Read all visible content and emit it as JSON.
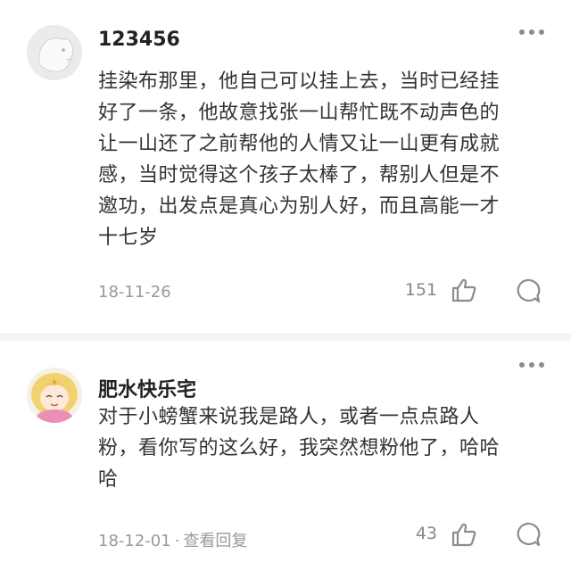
{
  "comments": [
    {
      "username": "123456",
      "avatar_icon": "dog-sketch-avatar",
      "text_lines": [
        "挂染布那里，他自己可以挂上去，当时已经挂",
        "好了一条，他故意找张一山帮忙既不动声色的",
        "让一山还了之前帮他的人情又让一山更有成就",
        "感，当时觉得这个孩子太棒了，帮别人但是不",
        "邀功，出发点是真心为别人好，而且高能一才",
        "十七岁"
      ],
      "date": "18-11-26",
      "likes": "151"
    },
    {
      "username": "肥水快乐宅",
      "avatar_icon": "sailor-moon-avatar",
      "text_lines": [
        "对于小螃蟹来说我是路人，或者一点点路人",
        "粉，看你写的这么好，我突然想粉他了，哈哈",
        "哈"
      ],
      "date": "18-12-01",
      "separator": "·",
      "view_replies": "查看回复",
      "likes": "43"
    }
  ],
  "colors": {
    "username": "#222222",
    "text": "#333333",
    "meta": "#999999",
    "icon": "#8c8c8c"
  }
}
